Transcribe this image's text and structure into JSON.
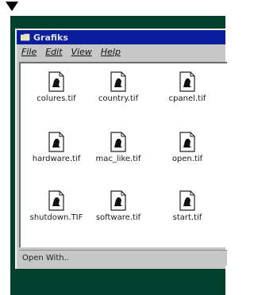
{
  "window": {
    "title": "Grafiks"
  },
  "menu": [
    {
      "label": "File"
    },
    {
      "label": "Edit"
    },
    {
      "label": "View"
    },
    {
      "label": "Help"
    }
  ],
  "files": [
    {
      "name": "colures.tif"
    },
    {
      "name": "country.tif"
    },
    {
      "name": "cpanel.tif"
    },
    {
      "name": "hardware.tif"
    },
    {
      "name": "mac_like.tif"
    },
    {
      "name": "open.tif"
    },
    {
      "name": "shutdown.TIF"
    },
    {
      "name": "software.tif"
    },
    {
      "name": "start.tif"
    }
  ],
  "status": {
    "text": "Open With.."
  },
  "colors": {
    "titlebar": "#0a1d9c",
    "desktop": "#04402e",
    "chrome": "#c7c7c7"
  },
  "icons": {
    "file_icon": "tif-document-icon",
    "app_icon": "folder-icon"
  }
}
